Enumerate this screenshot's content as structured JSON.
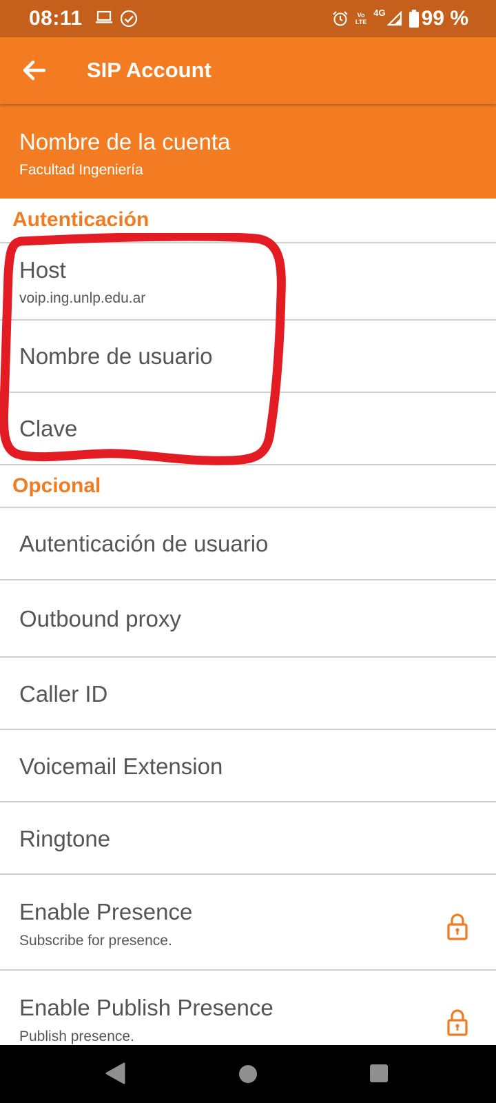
{
  "status_bar": {
    "time": "08:11",
    "network": "4G",
    "volte": "Vo’\nLTE",
    "battery": "99 %",
    "left_icons": [
      "laptop-icon",
      "check-circle-icon"
    ],
    "right_icons": [
      "alarm-icon",
      "volte-icon",
      "signal-icon",
      "battery-icon"
    ]
  },
  "app_bar": {
    "title": "SIP Account",
    "back_icon": "arrow-left-icon"
  },
  "account": {
    "title": "Nombre de la cuenta",
    "value": "Facultad Ingeniería"
  },
  "sections": {
    "authentication": {
      "title": "Autenticación",
      "items": [
        {
          "title": "Host",
          "summary": "voip.ing.unlp.edu.ar"
        },
        {
          "title": "Nombre de usuario"
        },
        {
          "title": "Clave"
        }
      ]
    },
    "optional": {
      "title": "Opcional",
      "items": [
        {
          "title": "Autenticación de usuario"
        },
        {
          "title": "Outbound proxy"
        },
        {
          "title": "Caller ID"
        },
        {
          "title": "Voicemail Extension"
        },
        {
          "title": "Ringtone"
        },
        {
          "title": "Enable Presence",
          "summary": "Subscribe for presence.",
          "icon": "lock-icon"
        },
        {
          "title": "Enable Publish Presence",
          "summary": "Publish presence.",
          "icon": "lock-icon"
        }
      ]
    }
  },
  "colors": {
    "status_bar": "#c4601b",
    "app_bar": "#f37c22",
    "accent": "#f07c22",
    "highlight": "#e31b23",
    "text": "#555555"
  },
  "annotation": {
    "type": "hand-drawn-outline",
    "color": "#e31b23",
    "encloses": [
      "Host",
      "Nombre de usuario",
      "Clave"
    ]
  },
  "nav_bar": {
    "icons": [
      "nav-back-icon",
      "nav-home-icon",
      "nav-recent-apps-icon"
    ]
  }
}
